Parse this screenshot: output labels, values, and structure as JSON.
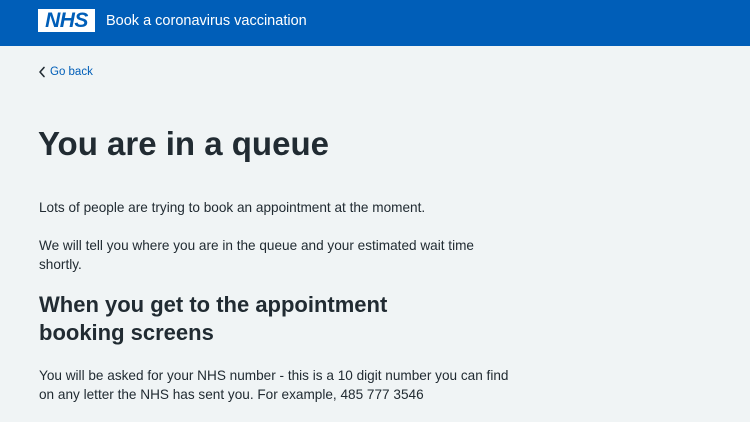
{
  "header": {
    "logo_text": "NHS",
    "service_name": "Book a coronavirus vaccination",
    "background_color": "#005eb8"
  },
  "nav": {
    "back_label": "Go back",
    "back_icon": "chevron-left-icon"
  },
  "main": {
    "title": "You are in a queue",
    "paragraph_1": "Lots of people are trying to book an appointment at the moment.",
    "paragraph_2": "We will tell you where you are in the queue and your estimated wait time shortly.",
    "subheading": "When you get to the appointment booking screens",
    "paragraph_3": "You will be asked for your NHS number - this is a 10 digit number you can find on any letter the NHS has sent you. For example, 485 777 3546"
  },
  "colors": {
    "page_background": "#f0f4f5",
    "link": "#005eb8",
    "text": "#212b32"
  }
}
